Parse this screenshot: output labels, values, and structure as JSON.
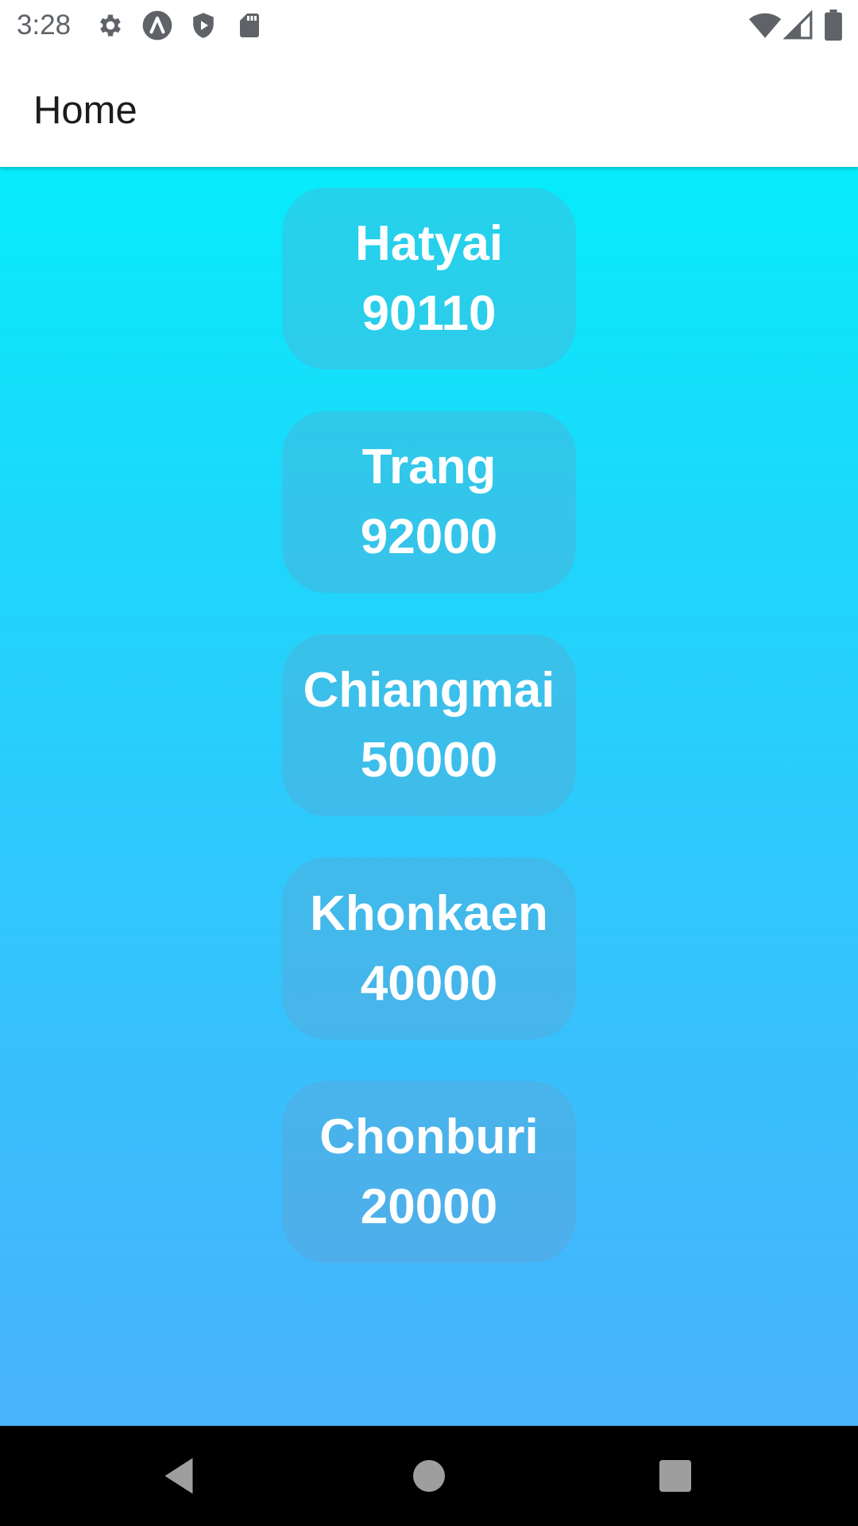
{
  "status_bar": {
    "time": "3:28",
    "left_icons": [
      "gear-icon",
      "app-a-icon",
      "shield-play-icon",
      "sd-card-icon"
    ],
    "right_icons": [
      "wifi-icon",
      "cell-signal-icon",
      "battery-icon"
    ]
  },
  "app_bar": {
    "title": "Home"
  },
  "cities": [
    {
      "name": "Hatyai",
      "zip": "90110"
    },
    {
      "name": "Trang",
      "zip": "92000"
    },
    {
      "name": "Chiangmai",
      "zip": "50000"
    },
    {
      "name": "Khonkaen",
      "zip": "40000"
    },
    {
      "name": "Chonburi",
      "zip": "20000"
    }
  ],
  "nav_bar": {
    "buttons": [
      "back-icon",
      "home-icon",
      "recents-icon"
    ]
  },
  "colors": {
    "gradient_top": "#06ecfc",
    "gradient_bottom": "#49b2fc",
    "card_text": "#ffffff"
  }
}
